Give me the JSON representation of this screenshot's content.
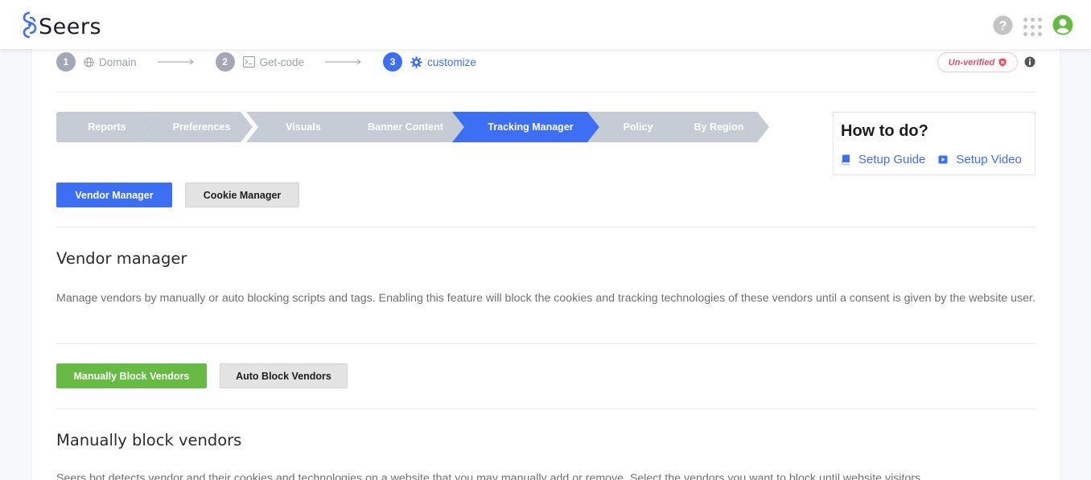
{
  "app": {
    "logo_text": "Seers"
  },
  "topbar": {
    "icons": [
      "help-icon",
      "apps-grid-icon",
      "user-account-icon"
    ],
    "help_color": "#c4c4c4",
    "user_color": "#67bb45"
  },
  "stepper": {
    "steps": [
      {
        "number": "1",
        "label": "Domain",
        "icon": "globe-icon",
        "state": "done"
      },
      {
        "number": "2",
        "label": "Get-code",
        "icon": "terminal-icon",
        "state": "done"
      },
      {
        "number": "3",
        "label": "customize",
        "icon": "gear-icon",
        "state": "active"
      }
    ]
  },
  "status": {
    "badge": "Un-verified",
    "badge_color": "#ef4a5e"
  },
  "tabs": {
    "items": [
      "Reports",
      "Preferences",
      "Visuals",
      "Banner Content",
      "Tracking Manager",
      "Policy",
      "By Region"
    ],
    "active": "Tracking Manager",
    "active_color": "#3d6ff4",
    "inactive_color": "#c5ccd6"
  },
  "howto": {
    "title": "How to do?",
    "guide_label": "Setup Guide",
    "video_label": "Setup Video"
  },
  "manager_toggle": {
    "vendor": "Vendor Manager",
    "cookie": "Cookie Manager",
    "active": "Vendor Manager"
  },
  "vendor_manager": {
    "title": "Vendor manager",
    "description": "Manage vendors by manually or auto blocking scripts and tags. Enabling this feature will block the cookies and tracking technologies of these vendors until a consent is given by the website user."
  },
  "block_toggle": {
    "manual": "Manually Block Vendors",
    "auto": "Auto Block Vendors",
    "active": "Manually Block Vendors",
    "active_color": "#67bb45"
  },
  "manual_block": {
    "title": "Manually block vendors",
    "description": "Seers bot detects vendor and their cookies and technologies on a website that you may manually add or remove. Select the vendors you want to block until website visitors"
  }
}
